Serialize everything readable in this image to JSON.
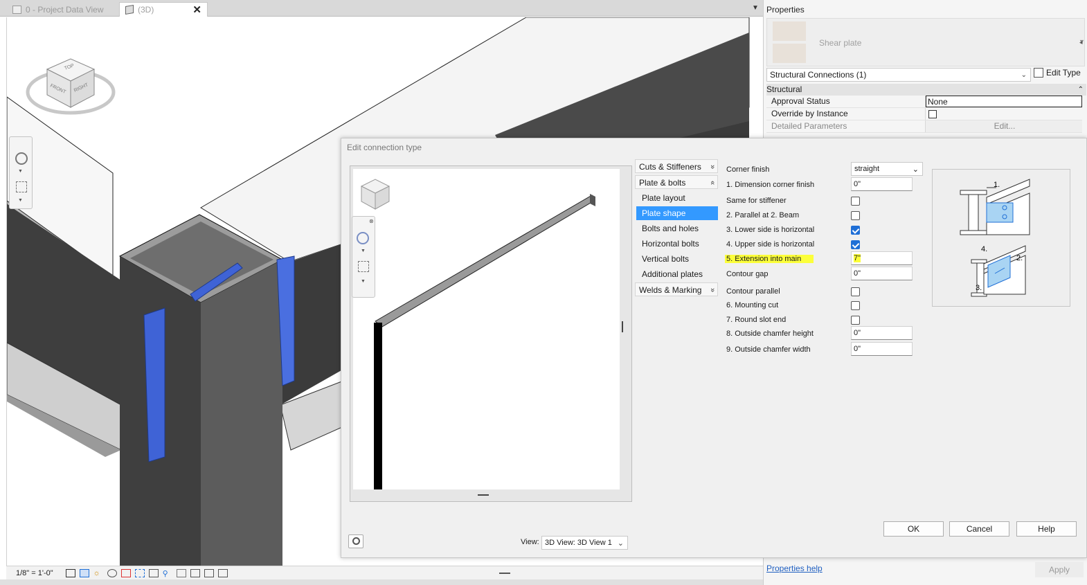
{
  "tabs": [
    {
      "label": "0 - Project Data View",
      "icon": "sheet-icon"
    },
    {
      "label": "(3D)",
      "icon": "3d-view-icon",
      "active": true
    }
  ],
  "view_bar": {
    "scale": "1/8\" = 1'-0\""
  },
  "properties": {
    "title": "Properties",
    "type_name": "Shear plate",
    "filter": "Structural Connections (1)",
    "edit_type": "Edit Type",
    "group": "Structural",
    "rows": [
      {
        "label": "Approval Status",
        "value": "None"
      },
      {
        "label": "Override by Instance",
        "value": ""
      },
      {
        "label": "Detailed Parameters",
        "value": "Edit..."
      }
    ],
    "help_link": "Properties help",
    "apply": "Apply"
  },
  "dialog": {
    "title": "Edit connection type",
    "nav": [
      {
        "label": "Cuts & Stiffeners",
        "kind": "group",
        "chev": "»"
      },
      {
        "label": "Plate & bolts",
        "kind": "group",
        "chev": "«"
      },
      {
        "label": "Plate layout",
        "kind": "item"
      },
      {
        "label": "Plate shape",
        "kind": "item",
        "selected": true
      },
      {
        "label": "Bolts and holes",
        "kind": "item"
      },
      {
        "label": "Horizontal bolts",
        "kind": "item"
      },
      {
        "label": "Vertical bolts",
        "kind": "item"
      },
      {
        "label": "Additional plates",
        "kind": "item"
      },
      {
        "label": "Welds & Marking",
        "kind": "group",
        "chev": "»"
      }
    ],
    "params": [
      {
        "label": "Corner finish",
        "type": "select",
        "value": "straight"
      },
      {
        "label": "1. Dimension corner finish",
        "type": "input",
        "value": "0\""
      },
      {
        "label": "Same for stiffener",
        "type": "checkbox",
        "checked": false
      },
      {
        "label": "2. Parallel at 2. Beam",
        "type": "checkbox",
        "checked": false
      },
      {
        "label": "3. Lower side is horizontal",
        "type": "checkbox",
        "checked": true
      },
      {
        "label": "4. Upper side is horizontal",
        "type": "checkbox",
        "checked": true
      },
      {
        "label": "5. Extension into main",
        "type": "input",
        "value": "7\"",
        "highlight": true
      },
      {
        "label": "Contour gap",
        "type": "input",
        "value": "0\""
      },
      {
        "label": "Contour parallel",
        "type": "checkbox",
        "checked": false
      },
      {
        "label": "6. Mounting cut",
        "type": "checkbox",
        "checked": false
      },
      {
        "label": "7. Round slot end",
        "type": "checkbox",
        "checked": false
      },
      {
        "label": "8. Outside chamfer height",
        "type": "input",
        "value": "0\""
      },
      {
        "label": "9. Outside chamfer width",
        "type": "input",
        "value": "0\""
      }
    ],
    "diagram_labels": [
      "1.",
      "2.",
      "3.",
      "4."
    ],
    "view_label": "View:",
    "view_value": "3D View: 3D View 1",
    "buttons": {
      "ok": "OK",
      "cancel": "Cancel",
      "help": "Help"
    }
  },
  "viewcube": {
    "top": "TOP",
    "front": "FRONT",
    "right": "RIGHT"
  },
  "colors": {
    "selection_blue": "#3f63d6",
    "nav_selected": "#3399ff",
    "highlight": "#fcff3a",
    "steel_dark": "#3a3a3a"
  }
}
